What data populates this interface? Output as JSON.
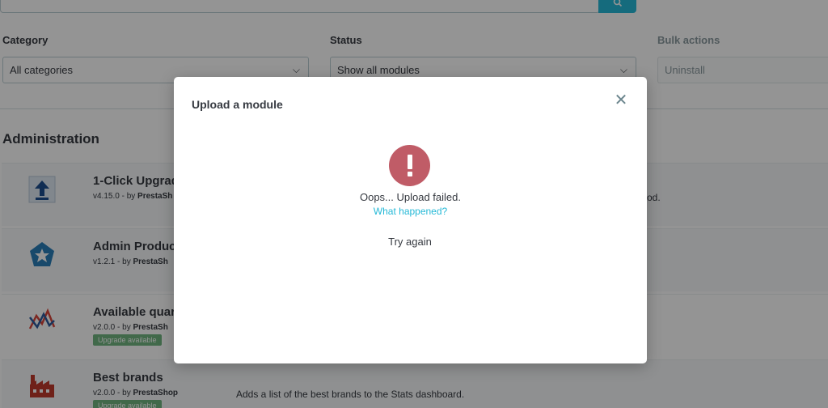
{
  "filters": {
    "category_label": "Category",
    "category_value": "All categories",
    "status_label": "Status",
    "status_value": "Show all modules",
    "bulk_label": "Bulk actions",
    "bulk_value": "Uninstall"
  },
  "section": {
    "title": "Administration"
  },
  "modules": [
    {
      "name": "1-Click Upgrad",
      "version": "v4.15.0 - by ",
      "author": "PrestaSh",
      "badge": "",
      "description": "od."
    },
    {
      "name": "Admin Product",
      "version": "v1.2.1 - by ",
      "author": "PrestaSh",
      "badge": "",
      "description": ""
    },
    {
      "name": "Available quar",
      "version": "v2.0.0 - by ",
      "author": "PrestaSh",
      "badge": "Upgrade available",
      "description": ""
    },
    {
      "name": "Best brands",
      "version": "v2.0.0 - by ",
      "author": "PrestaShop",
      "badge": "Upgrade available",
      "description": "Adds a list of the best brands to the Stats dashboard."
    }
  ],
  "modal": {
    "title": "Upload a module",
    "close_icon": "close-icon",
    "error_icon": "exclamation-icon",
    "error_color": "#c05c67",
    "error_message": "Oops... Upload failed.",
    "help_link": "What happened?",
    "retry_label": "Try again"
  },
  "colors": {
    "accent": "#25b9d7",
    "badge": "#70b580",
    "overlay": "rgba(0,0,0,0.42)"
  }
}
